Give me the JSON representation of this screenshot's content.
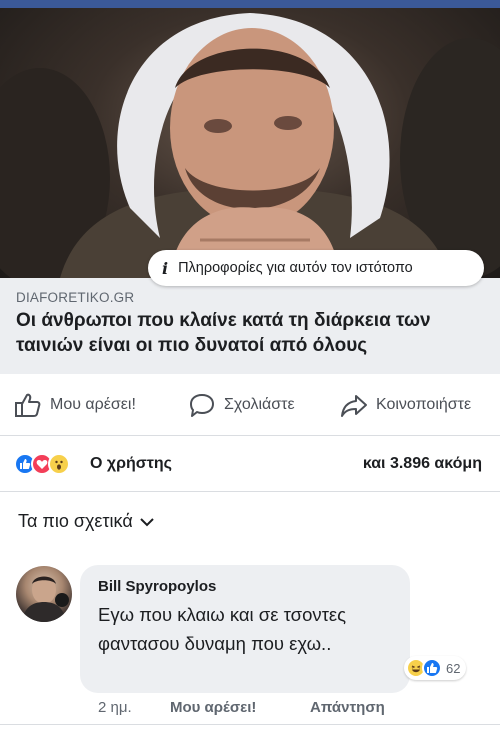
{
  "hero": {
    "info_text": "Πληροφορίες για αυτόν τον ιστότοπο"
  },
  "link": {
    "domain": "DIAFORETIKO.GR",
    "title": "Οι άνθρωποι που κλαίνε κατά τη διάρκεια των ταινιών είναι οι πιο δυνατοί από όλους"
  },
  "actions": {
    "like": "Μου αρέσει!",
    "comment": "Σχολιάστε",
    "share": "Κοινοποιήστε"
  },
  "reactions": {
    "icons": [
      "like-icon",
      "love-icon",
      "wow-icon"
    ],
    "user": "Ο χρήστης",
    "others": "και 3.896 ακόμη"
  },
  "sort": {
    "label": "Τα πιο σχετικά"
  },
  "comment": {
    "author": "Bill Spyropoylos",
    "text": "Εγω που κλαιω και σε τσοντες φαντασου δυναμη που εχω..",
    "reaction_count": "62",
    "time": "2 ημ.",
    "like_label": "Μου αρέσει!",
    "reply_label": "Απάντηση"
  },
  "colors": {
    "brand": "#3b5998",
    "like": "#1877f2",
    "love": "#f33e58",
    "wow": "#f7d04b"
  }
}
